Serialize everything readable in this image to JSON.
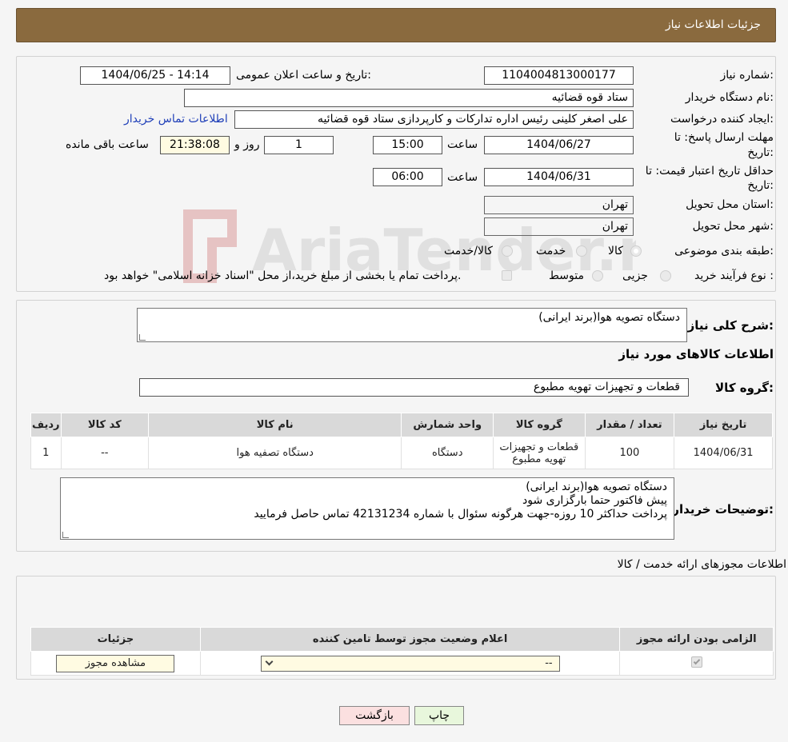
{
  "header": {
    "title": "جزئیات اطلاعات نیاز"
  },
  "form": {
    "need_number_label": "شماره نیاز:",
    "need_number": "1104004813000177",
    "announce_label": "تاریخ و ساعت اعلان عمومی:",
    "announce_value": "1404/06/25 - 14:14",
    "buyer_org_label": "نام دستگاه خریدار:",
    "buyer_org": "ستاد قوه قضائیه",
    "requester_label": "ایجاد کننده درخواست:",
    "requester": "علی اصغر کلینی رئیس اداره تدارکات و کارپردازی ستاد قوه قضائیه",
    "contact_link": "اطلاعات تماس خریدار",
    "deadline_label_1": "مهلت ارسال پاسخ: تا",
    "deadline_label_2": "تاریخ:",
    "deadline_date": "1404/06/27",
    "time_label": "ساعت",
    "deadline_time": "15:00",
    "days_value": "1",
    "days_label": "روز و",
    "remaining_time": "21:38:08",
    "remaining_label": "ساعت باقی مانده",
    "validity_label_1": "حداقل تاریخ اعتبار قیمت: تا",
    "validity_label_2": "تاریخ:",
    "validity_date": "1404/06/31",
    "validity_time": "06:00",
    "province_label": "استان محل تحویل:",
    "province": "تهران",
    "city_label": "شهر محل تحویل:",
    "city": "تهران",
    "category_label": "طبقه بندی موضوعی:",
    "category_options": [
      "کالا",
      "خدمت",
      "کالا/خدمت"
    ],
    "process_label": "نوع فرآیند خرید :",
    "process_options": [
      "جزیی",
      "متوسط"
    ],
    "process_note": "پرداخت تمام یا بخشی از مبلغ خرید،از محل \"اسناد خزانه اسلامی\" خواهد بود."
  },
  "summary": {
    "desc_label": "شرح کلی نیاز:",
    "desc_value": "دستگاه تصویه هوا(برند ایرانی)",
    "goods_info_title": "اطلاعات کالاهای مورد نیاز",
    "group_label": "گروه کالا:",
    "group_value": "قطعات و تجهیزات تهویه مطبوع"
  },
  "goods_table": {
    "headers": [
      "ردیف",
      "کد کالا",
      "نام کالا",
      "واحد شمارش",
      "گروه کالا",
      "تعداد / مقدار",
      "تاریخ نیاز"
    ],
    "rows": [
      [
        "1",
        "--",
        "دستگاه تصفیه هوا",
        "دستگاه",
        "قطعات و تجهیزات تهویه مطبوع",
        "100",
        "1404/06/31"
      ]
    ]
  },
  "buyer_notes": {
    "label": "توضیحات خریدار:",
    "lines": [
      "دستگاه تصویه هوا(برند ایرانی)",
      "پیش فاکتور حتما بارگزاری شود",
      "پرداخت حداکثر 10 روزه-جهت هرگونه سئوال با شماره 42131234 تماس حاصل فرمایید"
    ]
  },
  "permits": {
    "title": "اطلاعات مجوزهای ارائه خدمت / کالا",
    "headers": [
      "الزامی بودن ارائه مجوز",
      "اعلام وضعیت مجوز توسط تامین کننده",
      "جزئیات"
    ],
    "select_value": "--",
    "view_button": "مشاهده مجوز"
  },
  "footer": {
    "print_button": "چاپ",
    "back_button": "بازگشت"
  },
  "watermark": {
    "text": "AriaTender.neT"
  },
  "colors": {
    "header_bg": "#8a6a3e",
    "print_bg": "#e8f7dc",
    "back_bg": "#fbe0e0"
  }
}
